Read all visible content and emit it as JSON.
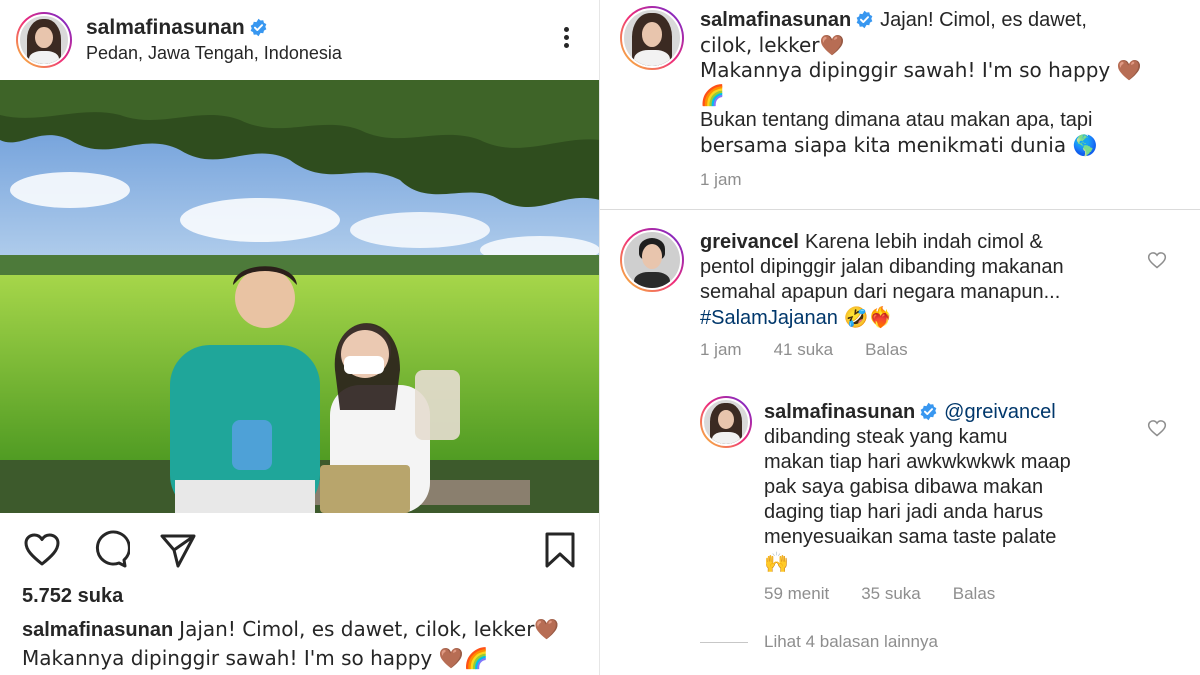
{
  "post": {
    "username": "salmafinasunan",
    "location": "Pedan, Jawa Tengah, Indonesia",
    "likes": "5.752 suka",
    "caption_line1": "Jajan! Cimol, es dawet, cilok, lekker🤎",
    "caption_line2": "Makannya dipinggir sawah! I'm so happy 🤎🌈"
  },
  "comments": {
    "owner": {
      "username": "salmafinasunan",
      "text_line1": "Jajan! Cimol, es dawet,",
      "text_line2": "cilok, lekker🤎",
      "text_line3": "Makannya dipinggir sawah! I'm so happy 🤎",
      "text_line4": "🌈",
      "text_line5": "Bukan tentang dimana atau makan apa, tapi",
      "text_line6": "bersama siapa kita menikmati dunia 🌎",
      "time": "1 jam"
    },
    "greivancel": {
      "username": "greivancel",
      "text_line1": "Karena lebih indah cimol &",
      "text_line2": "pentol dipinggir jalan dibanding makanan",
      "text_line3": "semahal apapun dari negara manapun...",
      "hashtag": "#SalamJajanan",
      "emojis": "🤣❤️‍🔥",
      "time": "1 jam",
      "likes": "41 suka",
      "reply": "Balas"
    },
    "reply": {
      "username": "salmafinasunan",
      "mention": "@greivancel",
      "text_line1": "dibanding steak yang kamu",
      "text_line2": "makan tiap hari awkwkwkwk maap",
      "text_line3": "pak saya gabisa dibawa makan",
      "text_line4": "daging tiap hari jadi anda harus",
      "text_line5": "menyesuaikan sama taste palate",
      "text_line6": "🙌",
      "time": "59 menit",
      "likes": "35 suka",
      "reply": "Balas"
    },
    "view_more": "Lihat 4 balasan lainnya"
  },
  "icons": {
    "verified": "verified-badge-icon",
    "more": "more-options-icon",
    "like": "heart-icon",
    "comment": "comment-icon",
    "share": "share-icon",
    "save": "bookmark-icon"
  },
  "colors": {
    "verified_blue": "#3897f0",
    "link_blue": "#00376b",
    "meta_gray": "#8e8e8e"
  }
}
